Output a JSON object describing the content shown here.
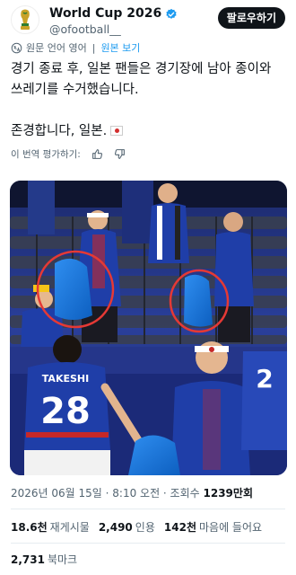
{
  "account": {
    "display_name": "World Cup 2026",
    "handle": "@ofootball__",
    "follow_label": "팔로우하기"
  },
  "translation": {
    "original_lang": "원문 언어 영어",
    "separator": "|",
    "view_original": "원본 보기"
  },
  "tweet": {
    "line1": "경기 종료 후, 일본 팬들은 경기장에 남아 종이와 쓰레기를 수거했습니다.",
    "line2": "존경합니다, 일본.",
    "flag_icon": "japan-flag"
  },
  "rating": {
    "label": "이 번역 평가하기:",
    "up_icon": "thumbs-up-icon",
    "down_icon": "thumbs-down-icon"
  },
  "photo": {
    "jersey_number": "28",
    "jersey_name": "TAKESHI",
    "jersey_number_right": "2",
    "highlight_color": "#e53935"
  },
  "meta": {
    "date_time": "2026년 06월 15일 · 8:10 오전 · 조회수 ",
    "views": "1239만회"
  },
  "stats": {
    "retweets_count": "18.6천",
    "retweets_label": "재게시물",
    "quotes_count": "2,490",
    "quotes_label": "인용",
    "likes_count": "142천",
    "likes_label": "마음에 들어요",
    "bookmarks_count": "2,731",
    "bookmarks_label": "북마크"
  },
  "colors": {
    "accent": "#1d9bf0",
    "text": "#0f1419",
    "muted": "#536471"
  }
}
